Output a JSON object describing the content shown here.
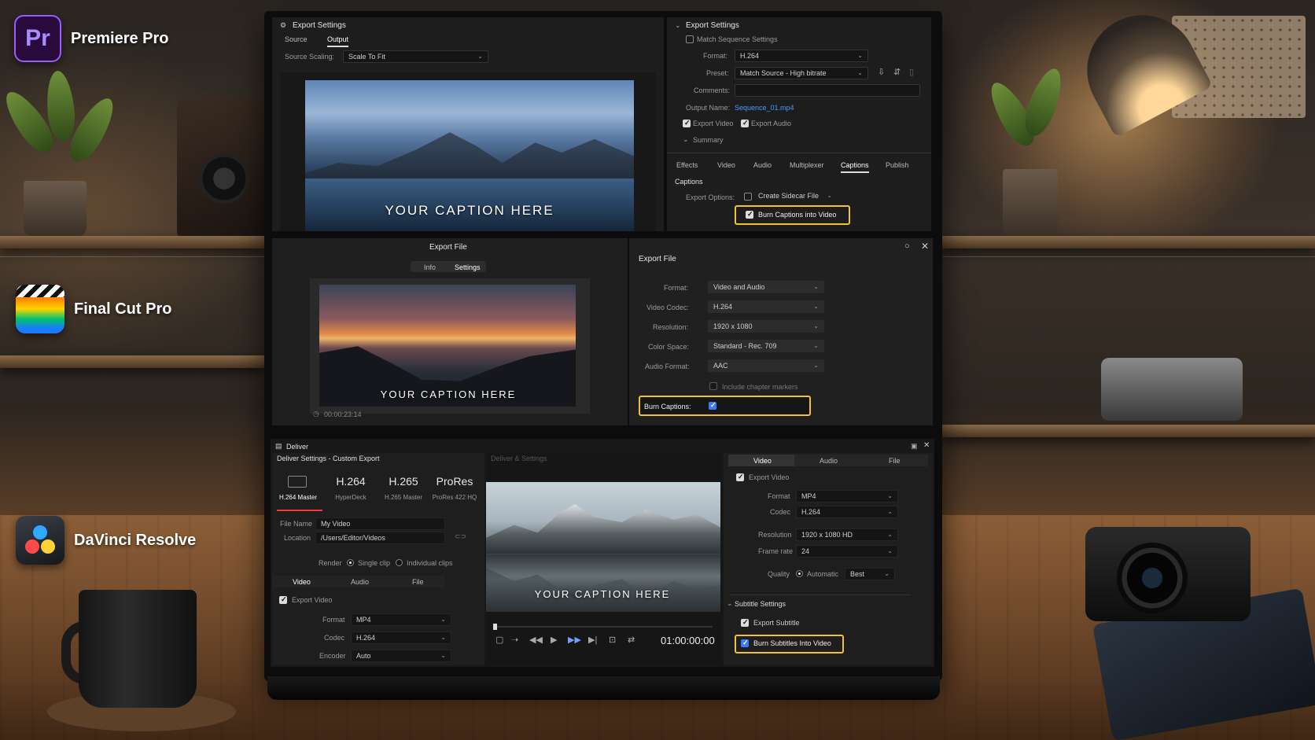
{
  "apps": {
    "premiere": {
      "name": "Premiere Pro",
      "icon_text": "Pr"
    },
    "fcp": {
      "name": "Final Cut Pro"
    },
    "resolve": {
      "name": "DaVinci Resolve"
    }
  },
  "colors": {
    "highlight": "#f2c230",
    "premiere_accent": "#9a5cff",
    "link_blue": "#4a9bff"
  },
  "premiere": {
    "left_title": "Export Settings",
    "tabs": [
      "Source",
      "Output"
    ],
    "source_scaling_label": "Source Scaling:",
    "source_scaling_value": "Scale To Fit",
    "caption": "YOUR CAPTION HERE",
    "right_title": "Export Settings",
    "match_sequence": "Match Sequence Settings",
    "format_label": "Format:",
    "format_value": "H.264",
    "preset_label": "Preset:",
    "preset_value": "Match Source - High bitrate",
    "comments_label": "Comments:",
    "output_name_label": "Output Name:",
    "output_name_value": "Sequence_01.mp4",
    "export_video": "Export Video",
    "export_audio": "Export Audio",
    "summary": "Summary",
    "settings_tabs": [
      "Effects",
      "Video",
      "Audio",
      "Multiplexer",
      "Captions",
      "Publish"
    ],
    "captions_heading": "Captions",
    "export_options_label": "Export Options:",
    "export_options_value": "Create Sidecar File",
    "burn_captions": "Burn Captions into Video"
  },
  "fcp": {
    "left_title": "Export File",
    "tabs": [
      "Info",
      "Settings"
    ],
    "caption": "YOUR CAPTION HERE",
    "timecode": "00:00:23:14",
    "right_title": "Export File",
    "rows": [
      {
        "label": "Format:",
        "value": "Video and Audio"
      },
      {
        "label": "Video Codec:",
        "value": "H.264"
      },
      {
        "label": "Resolution:",
        "value": "1920 x 1080"
      },
      {
        "label": "Color Space:",
        "value": "Standard - Rec. 709"
      },
      {
        "label": "Audio Format:",
        "value": "AAC"
      }
    ],
    "chapter_markers": "Include chapter markers",
    "burn_captions": "Burn Captions:"
  },
  "resolve": {
    "title": "Deliver",
    "settings_title": "Deliver Settings - Custom Export",
    "codecs": [
      {
        "big": "",
        "small": "H.264 Master"
      },
      {
        "big": "H.264",
        "small": "HyperDeck"
      },
      {
        "big": "H.265",
        "small": "H.265 Master"
      },
      {
        "big": "ProRes",
        "small": "ProRes 422 HQ"
      }
    ],
    "file_name_label": "File Name",
    "file_name_value": "My Video",
    "location_label": "Location",
    "location_value": "/Users/Editor/Videos",
    "render_label": "Render",
    "single_clip": "Single clip",
    "individual_clips": "Individual clips",
    "left_tabs": [
      "Video",
      "Audio",
      "File"
    ],
    "export_video": "Export Video",
    "format_label": "Format",
    "format_value": "MP4",
    "codec_label": "Codec",
    "codec_value": "H.264",
    "encoder_label": "Encoder",
    "encoder_value": "Auto",
    "preview_header": "Deliver & Settings",
    "caption": "YOUR CAPTION HERE",
    "timecode": "01:00:00:00",
    "right_tabs": [
      "Video",
      "Audio",
      "File"
    ],
    "r_export_video": "Export Video",
    "r_format_label": "Format",
    "r_format_value": "MP4",
    "r_codec_label": "Codec",
    "r_codec_value": "H.264",
    "resolution_label": "Resolution",
    "resolution_value": "1920 x 1080 HD",
    "frame_rate_label": "Frame rate",
    "frame_rate_value": "24",
    "quality_label": "Quality",
    "quality_auto": "Automatic",
    "quality_value": "Best",
    "subtitle_settings": "Subtitle Settings",
    "export_subtitle": "Export Subtitle",
    "burn_subtitles": "Burn Subtitles Into Video"
  }
}
